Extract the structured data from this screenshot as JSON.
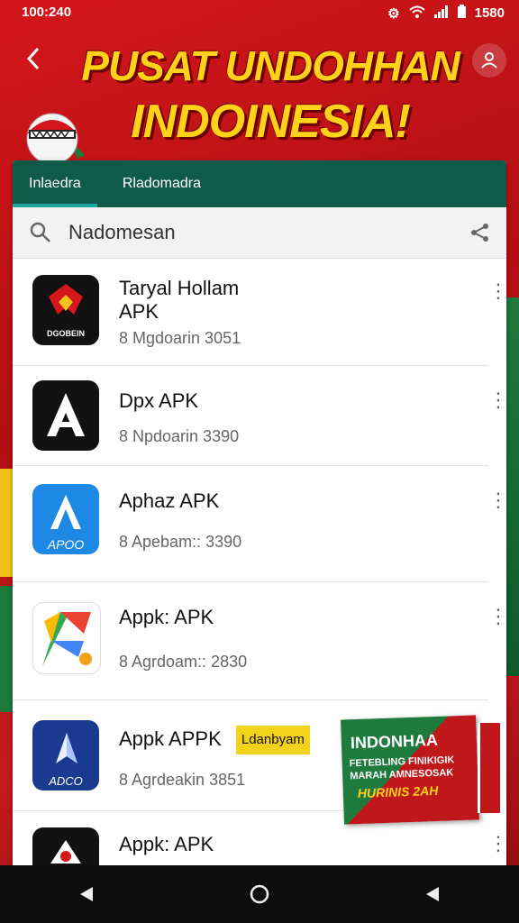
{
  "status_bar": {
    "time": "100:240",
    "battery_text": "1580"
  },
  "header": {
    "headline_line1": "PUSAT UNDOHHAN",
    "headline_line2": "INDOINESIA!"
  },
  "tabs": [
    {
      "label": "Inlaedra",
      "active": true
    },
    {
      "label": "Rladomadra",
      "active": false
    }
  ],
  "search": {
    "query": "Nadomesan"
  },
  "apps": [
    {
      "title_line1": "Taryal Hollam",
      "title_line2": "APK",
      "meta": "8 Mgdoarin   3051",
      "icon": "brand-logo-dark-red",
      "icon_text": "DGOBEIN"
    },
    {
      "title_line1": "Dpx APK",
      "meta": "8 Npdoarin   3390",
      "icon": "letter-a-icon-black"
    },
    {
      "title_line1": "Aphaz APK",
      "meta": "8 Apebam::   3390",
      "icon": "letter-a-icon-blue",
      "icon_text": "APOO"
    },
    {
      "title_line1": "Appk: APK",
      "meta": "8 Agrdoam::   2830",
      "icon": "colorful-a-icon"
    },
    {
      "title_line1": "Appk APPK",
      "badge": "Ldanbyam",
      "meta": "8 Agrdeakin   3851",
      "icon": "paper-icon-navy",
      "icon_text": "ADCO"
    },
    {
      "title_line1": "Appk: APK",
      "meta": "",
      "icon": "partial-icon-dark"
    }
  ],
  "promo": {
    "title": "INDONHAA",
    "subtitle": "FETEBLING FINIKIGIK MARAH AMNESOSAK",
    "tagline": "HURINIS 2AH"
  },
  "colors": {
    "accent_red": "#c0171b",
    "tab_green": "#0f5a48",
    "headline_yellow": "#ffd21a"
  }
}
